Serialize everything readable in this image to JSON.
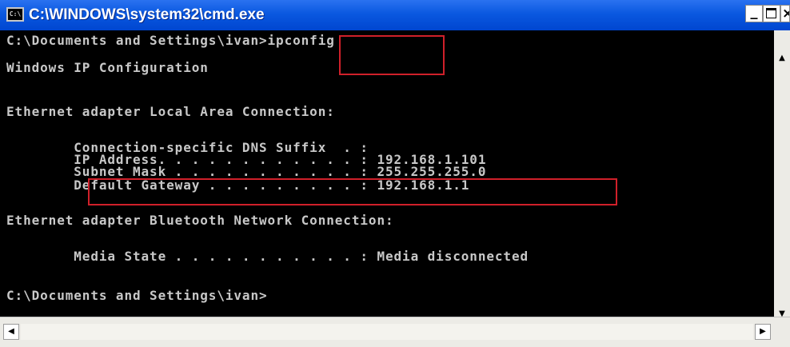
{
  "window": {
    "title": "C:\\WINDOWS\\system32\\cmd.exe",
    "icon_label": "C:\\",
    "buttons": {
      "minimize": "_",
      "close": "×"
    }
  },
  "console": {
    "lines": [
      "C:\\Documents and Settings\\ivan>ipconfig",
      "Windows IP Configuration",
      "Ethernet adapter Local Area Connection:",
      "        Connection-specific DNS Suffix  . :",
      "        IP Address. . . . . . . . . . . . : 192.168.1.101",
      "        Subnet Mask . . . . . . . . . . . : 255.255.255.0",
      "        Default Gateway . . . . . . . . . : 192.168.1.1",
      "Ethernet adapter Bluetooth Network Connection:",
      "        Media State . . . . . . . . . . . : Media disconnected",
      "C:\\Documents and Settings\\ivan>"
    ]
  },
  "scrollbars": {
    "up_arrow": "▲",
    "down_arrow": "▼",
    "left_arrow": "◀",
    "right_arrow": "▶"
  },
  "highlight_color": "#d0202a"
}
